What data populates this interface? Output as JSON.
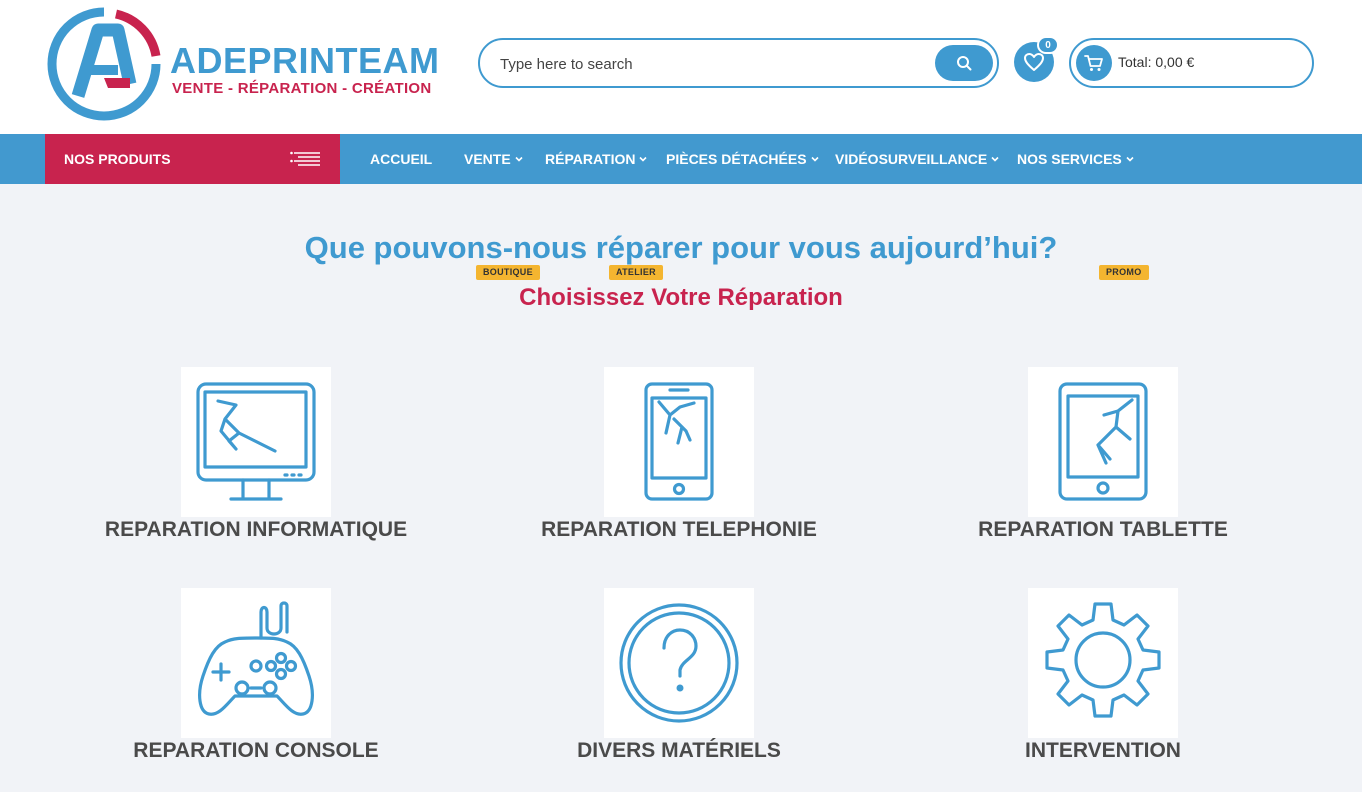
{
  "brand": {
    "name": "ADEPRINTEAM",
    "tagline": "VENTE - RÉPARATION - CRÉATION",
    "logo_letter": "A",
    "primary_color": "#3f9ad0",
    "accent_color": "#c8234e"
  },
  "search": {
    "placeholder": "Type here to search",
    "icon": "search-icon"
  },
  "wishlist": {
    "count": "0",
    "icon": "heart-icon"
  },
  "cart": {
    "total_label": "Total: 0,00 €",
    "icon": "cart-icon"
  },
  "nav": {
    "products_label": "NOS PRODUITS",
    "items": [
      {
        "label": "ACCUEIL",
        "badge": ""
      },
      {
        "label": "VENTE",
        "badge": "BOUTIQUE"
      },
      {
        "label": "RÉPARATION",
        "badge": "ATELIER"
      },
      {
        "label": "PIÈCES DÉTACHÉES",
        "badge": ""
      },
      {
        "label": "VIDÉOSURVEILLANCE",
        "badge": ""
      },
      {
        "label": "NOS SERVICES",
        "badge": "PROMO"
      }
    ],
    "badge_color": "#f4b530"
  },
  "main": {
    "title": "Que pouvons-nous réparer pour vous aujourd’hui?",
    "subtitle": "Choisissez Votre Réparation",
    "categories": [
      {
        "label": "REPARATION INFORMATIQUE",
        "icon": "broken-monitor-icon"
      },
      {
        "label": "REPARATION TELEPHONIE",
        "icon": "broken-phone-icon"
      },
      {
        "label": "REPARATION TABLETTE",
        "icon": "broken-tablet-icon"
      },
      {
        "label": "REPARATION CONSOLE",
        "icon": "gamepad-icon"
      },
      {
        "label": "DIVERS MATÉRIELS",
        "icon": "question-icon"
      },
      {
        "label": "INTERVENTION",
        "icon": "gear-icon"
      }
    ]
  }
}
